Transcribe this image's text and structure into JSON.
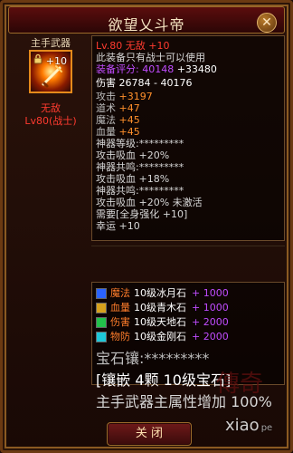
{
  "window": {
    "title": "欲望乂斗帝",
    "close_label": "✕"
  },
  "item_slot": {
    "title": "主手武器",
    "enhance": "+10",
    "lock_name": "lock-icon",
    "state": "无敌",
    "level_class": "Lv80(战士)"
  },
  "details": {
    "header": "Lv.80 无敌 +10",
    "req1": "此装备只有战士可以使用",
    "score_label": "装备评分:",
    "score_value": "40148",
    "score_bonus": "+33480",
    "damage_label": "伤害",
    "damage_value": "26784 - 40176",
    "lines": [
      {
        "label": "攻击",
        "value": "+3197",
        "color": "orange"
      },
      {
        "label": "道术",
        "value": "+47",
        "color": "orange"
      },
      {
        "label": "魔法",
        "value": "+45",
        "color": "orange"
      },
      {
        "label": "血量",
        "value": "+45",
        "color": "orange"
      }
    ],
    "gem_level": "神器等级:*********",
    "lifesteal1": "攻击吸血 +20%",
    "resonance1": "神器共鸣:*********",
    "lifesteal2": "攻击吸血 +18%",
    "resonance2": "神器共鸣:*********",
    "lifesteal3": "攻击吸血 +20% 未激活",
    "need": "需要[全身强化 +10]",
    "luck": "幸运 +10"
  },
  "gems": {
    "rows": [
      {
        "type": "魔法",
        "desc": "10级冰月石",
        "value": "+ 1000",
        "icon": "blue"
      },
      {
        "type": "血量",
        "desc": "10级青木石",
        "value": "+ 1000",
        "icon": "gold"
      },
      {
        "type": "伤害",
        "desc": "10级天地石",
        "value": "+ 2000",
        "icon": "green"
      },
      {
        "type": "物防",
        "desc": "10级金刚石",
        "value": "+ 2000",
        "icon": "cyan"
      }
    ],
    "stars": "宝石镶:*********",
    "inlay": "[镶嵌 4颗 10级宝石]",
    "bonus": "主手武器主属性增加 100%"
  },
  "footer": {
    "close_button": "关 闭"
  },
  "watermark": {
    "brand1": "傳奇",
    "brand2": "xiao",
    "brand_small": "pe",
    "corner": "Ⅲ"
  },
  "colors": {
    "accent": "#ff3b2f",
    "gold": "#e8d7b6",
    "frame": "#6b3a12"
  }
}
